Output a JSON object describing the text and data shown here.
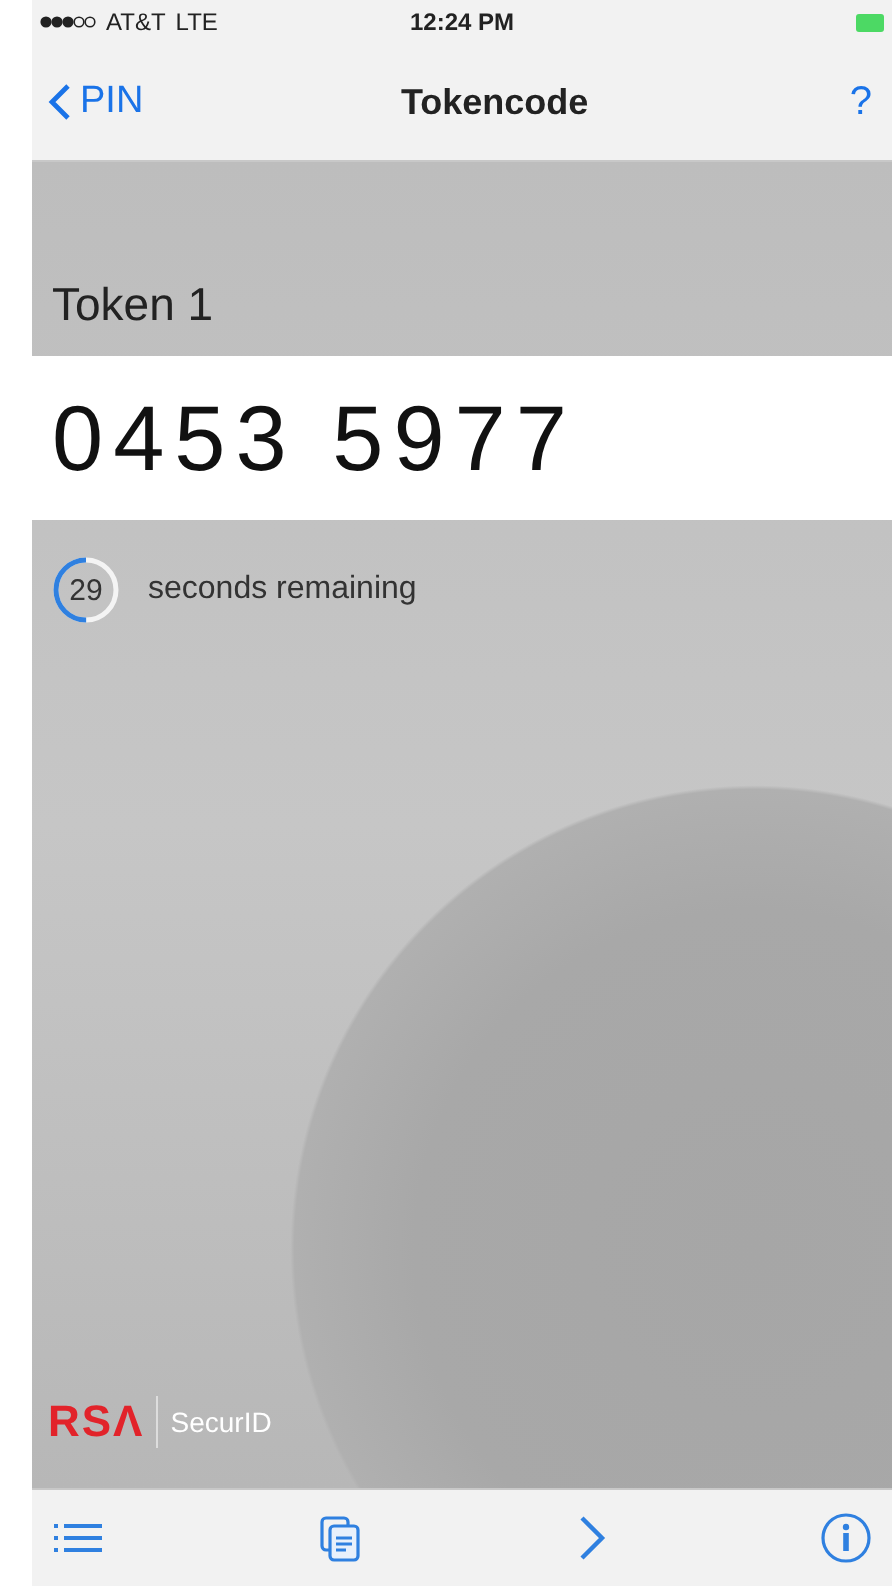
{
  "status_bar": {
    "carrier": "AT&T",
    "network": "LTE",
    "time": "12:24 PM"
  },
  "nav": {
    "back": "PIN",
    "title": "Tokencode",
    "help": "?"
  },
  "token": {
    "name": "Token 1",
    "code": "0453 5977"
  },
  "countdown": {
    "seconds": "29",
    "label": "seconds remaining",
    "level": 0.5
  },
  "brand": {
    "logo": "RSΛ",
    "product": "SecurID"
  },
  "toolbar": [
    {
      "kind": "list"
    },
    {
      "kind": "copy"
    },
    {
      "kind": "next"
    },
    {
      "kind": "info"
    }
  ]
}
